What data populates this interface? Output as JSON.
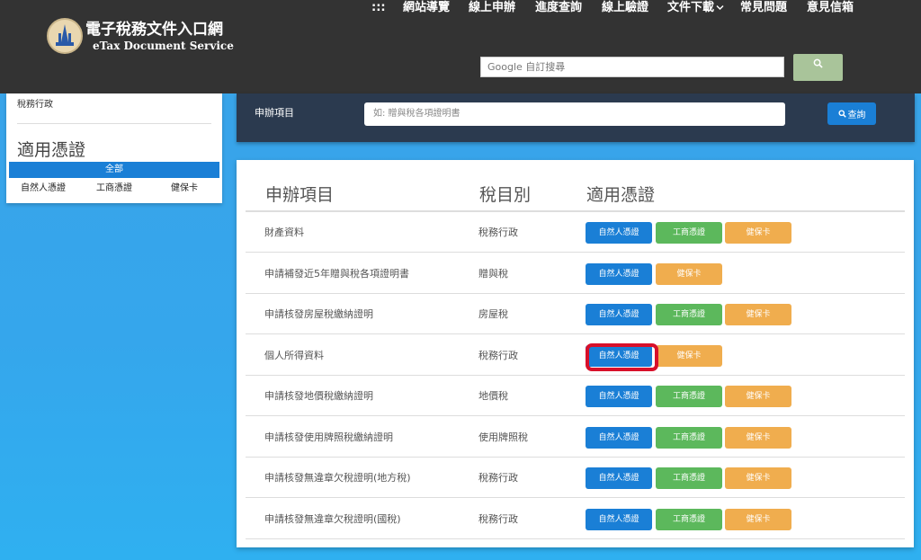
{
  "header": {
    "logo_title": "電子稅務文件入口網",
    "logo_subtitle": "eTax Document Service",
    "nav": [
      ":::",
      "網站導覽",
      "線上申辦",
      "進度查詢",
      "線上驗證",
      "文件下載",
      "常見問題",
      "意見信箱"
    ],
    "google_search_placeholder": "Google 自訂搜尋"
  },
  "sidebar": {
    "category": "稅務行政",
    "title": "適用憑證",
    "all_label": "全部",
    "filters": [
      "自然人憑證",
      "工商憑證",
      "健保卡"
    ]
  },
  "search_panel": {
    "label": "申辦項目",
    "placeholder": "如: 贈與稅各項證明書",
    "button_label": "查詢"
  },
  "table": {
    "headers": [
      "申辦項目",
      "稅目別",
      "適用憑證"
    ],
    "rows": [
      {
        "item": "財產資料",
        "tax": "稅務行政",
        "certs": [
          "自然人憑證",
          "工商憑證",
          "健保卡"
        ]
      },
      {
        "item": "申請補發近5年贈與稅各項證明書",
        "tax": "贈與稅",
        "certs": [
          "自然人憑證",
          "健保卡"
        ]
      },
      {
        "item": "申請核發房屋稅繳納證明",
        "tax": "房屋稅",
        "certs": [
          "自然人憑證",
          "工商憑證",
          "健保卡"
        ]
      },
      {
        "item": "個人所得資料",
        "tax": "稅務行政",
        "certs": [
          "自然人憑證",
          "健保卡"
        ]
      },
      {
        "item": "申請核發地價稅繳納證明",
        "tax": "地價稅",
        "certs": [
          "自然人憑證",
          "工商憑證",
          "健保卡"
        ]
      },
      {
        "item": "申請核發使用牌照稅繳納證明",
        "tax": "使用牌照稅",
        "certs": [
          "自然人憑證",
          "工商憑證",
          "健保卡"
        ]
      },
      {
        "item": "申請核發無違章欠稅證明(地方稅)",
        "tax": "稅務行政",
        "certs": [
          "自然人憑證",
          "工商憑證",
          "健保卡"
        ]
      },
      {
        "item": "申請核發無違章欠稅證明(國稅)",
        "tax": "稅務行政",
        "certs": [
          "自然人憑證",
          "工商憑證",
          "健保卡"
        ]
      }
    ]
  },
  "colors": {
    "natural": "#1a7fd6",
    "business": "#5cb85c",
    "health": "#f0ad4e",
    "highlight": "#d8102a"
  }
}
